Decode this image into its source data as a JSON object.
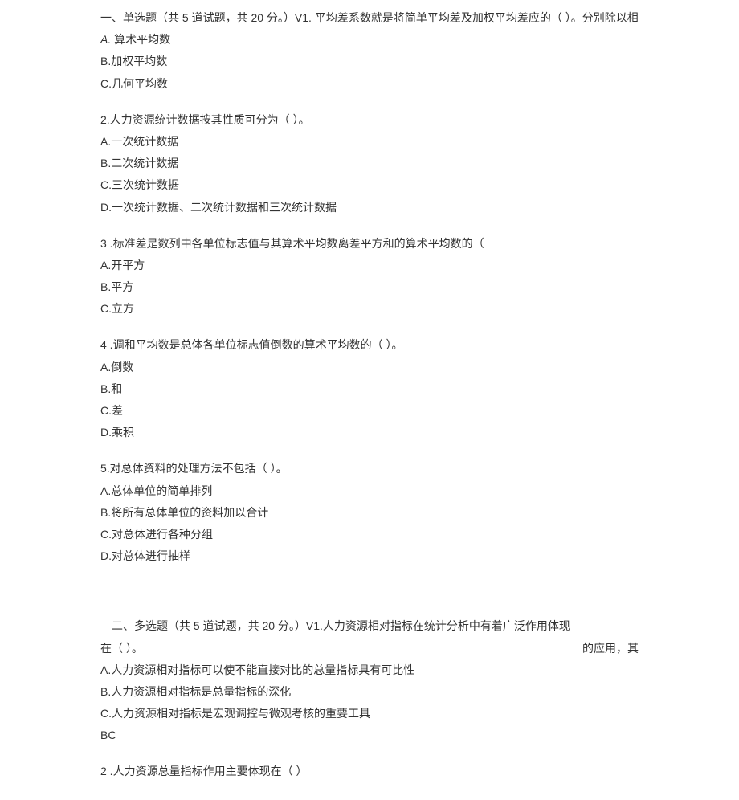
{
  "section1": {
    "header_with_q1": "一、单选题（共 5 道试题，共 20 分。）V1. 平均差系数就是将简单平均差及加权平均差应的（ ）。分别除以相",
    "q1": {
      "optA_prefix": "A.",
      "optA_text": " 算术平均数",
      "optB": "B.加权平均数",
      "optC": "C.几何平均数"
    },
    "q2": {
      "stem": "2.人力资源统计数据按其性质可分为（ ）。",
      "optA": "A.一次统计数据",
      "optB": "B.二次统计数据",
      "optC": "C.三次统计数据",
      "optD": "D.一次统计数据、二次统计数据和三次统计数据"
    },
    "q3": {
      "stem": "3 .标准差是数列中各单位标志值与其算术平均数离差平方和的算术平均数的（",
      "optA": "A.开平方",
      "optB": "B.平方",
      "optC": "C.立方"
    },
    "q4": {
      "stem": "4 .调和平均数是总体各单位标志值倒数的算术平均数的（ ）。",
      "optA": "A.倒数",
      "optB": "B.和",
      "optC": "C.差",
      "optD": "D.乘积"
    },
    "q5": {
      "stem": "5.对总体资料的处理方法不包括（ ）。",
      "optA": "A.总体单位的简单排列",
      "optB": "B.将所有总体单位的资料加以合计",
      "optC": "C.对总体进行各种分组",
      "optD": "D.对总体进行抽样"
    }
  },
  "section2": {
    "header_with_q1_part1": "二、多选题（共 5 道试题，共 20 分。）V1.人力资源相对指标在统计分析中有着广泛作用体现",
    "q1_line2_left": "在（ ）。",
    "q1_line2_right": "的应用，其",
    "q1": {
      "optA": "A.人力资源相对指标可以使不能直接对比的总量指标具有可比性",
      "optB": "B.人力资源相对指标是总量指标的深化",
      "optC": "C.人力资源相对指标是宏观调控与微观考核的重要工具",
      "answer": "BC"
    },
    "q2": {
      "stem": "2 .人力资源总量指标作用主要体现在（ ）"
    }
  }
}
